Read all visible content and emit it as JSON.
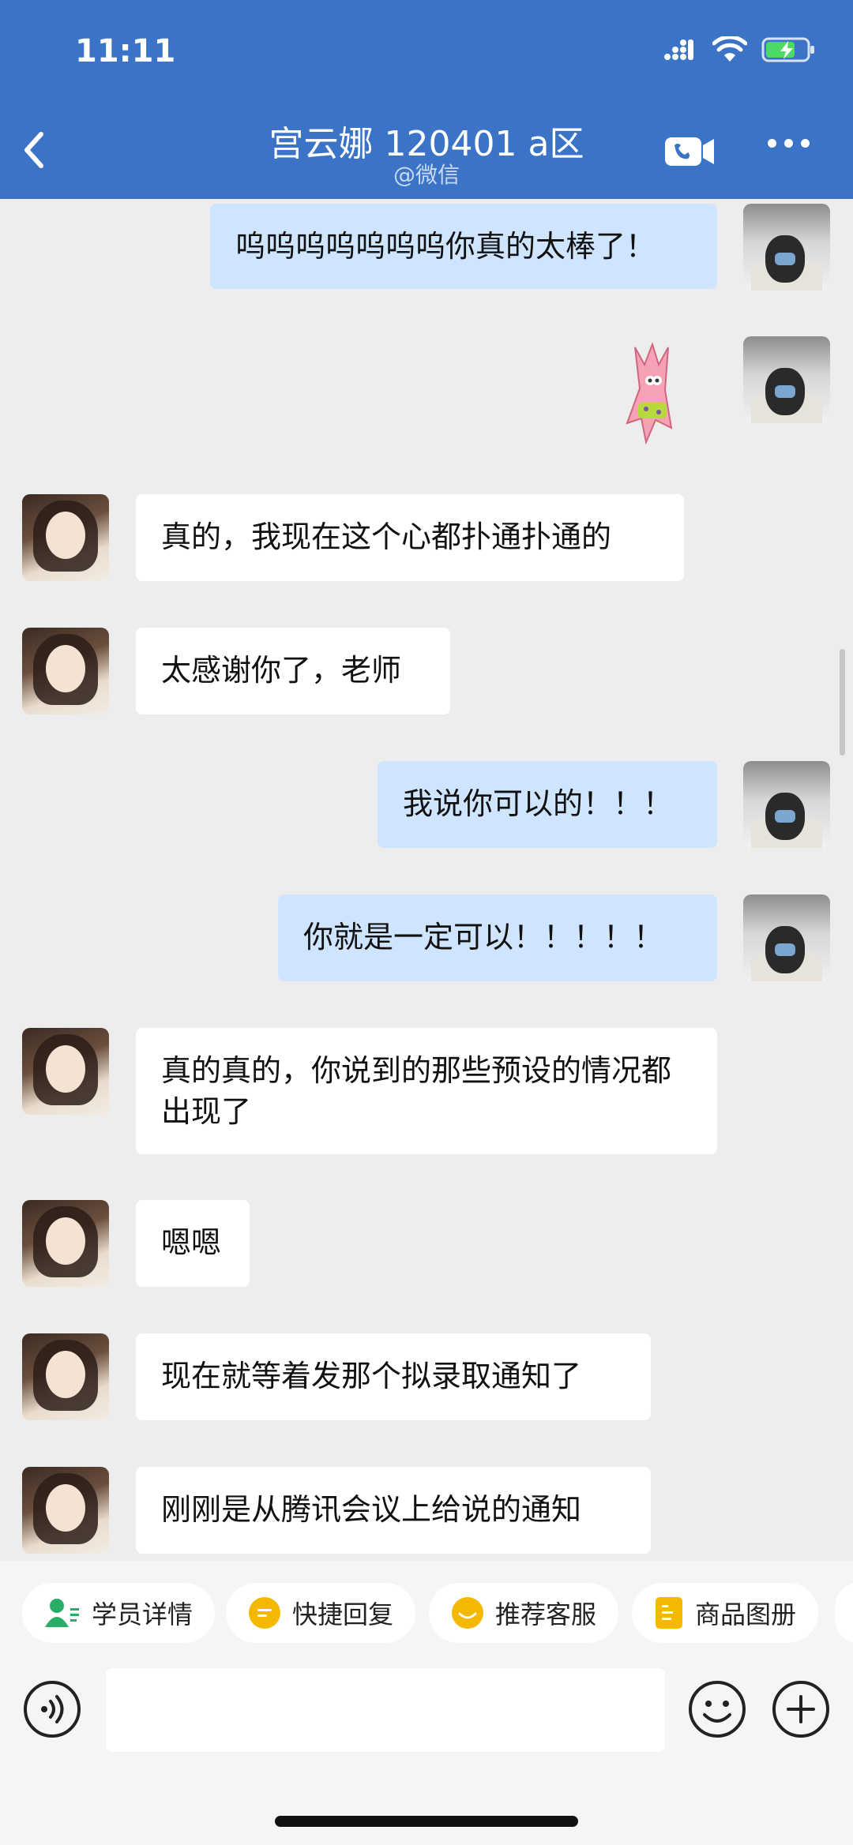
{
  "status_bar": {
    "time": "11:11"
  },
  "header": {
    "title": "宫云娜 120401 a区",
    "subtitle": "@微信"
  },
  "messages": [
    {
      "side": "self",
      "text": "呜呜呜呜呜呜呜你真的太棒了！"
    },
    {
      "side": "self",
      "type": "sticker",
      "sticker": "patrick-star-sticker"
    },
    {
      "side": "other",
      "text": "真的，我现在这个心都扑通扑通的"
    },
    {
      "side": "other",
      "text": "太感谢你了，老师"
    },
    {
      "side": "self",
      "text": "我说你可以的！！！"
    },
    {
      "side": "self",
      "text": "你就是一定可以！！！！！"
    },
    {
      "side": "other",
      "text": "真的真的，你说到的那些预设的情况都出现了"
    },
    {
      "side": "other",
      "text": "嗯嗯"
    },
    {
      "side": "other",
      "text": "现在就等着发那个拟录取通知了"
    },
    {
      "side": "other",
      "text": "刚刚是从腾讯会议上给说的通知"
    }
  ],
  "quick_actions": [
    {
      "label": "学员详情",
      "icon": "student-icon",
      "color": "#2aae67"
    },
    {
      "label": "快捷回复",
      "icon": "quick-reply-icon",
      "color": "#f5b800"
    },
    {
      "label": "推荐客服",
      "icon": "service-icon",
      "color": "#f5b800"
    },
    {
      "label": "商品图册",
      "icon": "catalog-icon",
      "color": "#f5b800"
    }
  ],
  "input": {
    "placeholder": ""
  },
  "colors": {
    "header": "#3b74c7",
    "self_bubble": "#cfe5ff",
    "other_bubble": "#ffffff",
    "background": "#ededed"
  }
}
